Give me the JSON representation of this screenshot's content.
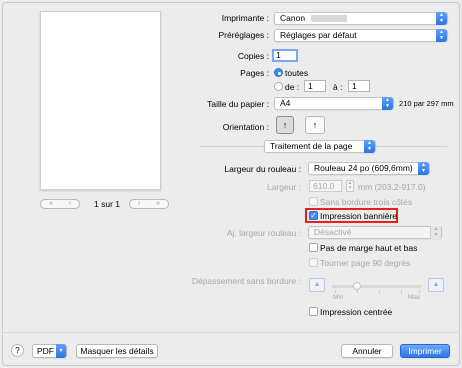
{
  "preview": {
    "page_indicator": "1 sur 1",
    "first_label": "«",
    "prev_label": "‹",
    "next_label": "›",
    "last_label": "»"
  },
  "printer": {
    "label": "Imprimante :",
    "value": "Canon"
  },
  "presets": {
    "label": "Préréglages :",
    "value": "Réglages par défaut"
  },
  "copies": {
    "label": "Copies :",
    "value": "1"
  },
  "pages": {
    "label": "Pages :",
    "all_label": "toutes",
    "from_label": "de :",
    "from_value": "1",
    "to_label": "à :",
    "to_value": "1"
  },
  "paper_size": {
    "label": "Taille du papier :",
    "value": "A4",
    "dims": "210 par 297 mm"
  },
  "orientation": {
    "label": "Orientation :",
    "portrait_glyph": "↑",
    "landscape_glyph": "↑"
  },
  "section": {
    "value": "Traitement de la page"
  },
  "roll_width": {
    "label": "Largeur du rouleau :",
    "value": "Rouleau 24 po (609,6mm)"
  },
  "width": {
    "label": "Largeur :",
    "value": "610.0",
    "unit": "mm (203.2-917.0)"
  },
  "checkboxes": {
    "borderless_three": "Sans bordure trois côtés",
    "banner": "Impression bannière",
    "no_margin": "Pas de marge haut et bas",
    "rotate": "Tourner page 90 degrés",
    "center": "Impression centrée"
  },
  "adjust_width": {
    "label": "Aj. largeur rouleau :",
    "value": "Désactivé"
  },
  "overflow": {
    "label": "Dépassement sans bordure :",
    "min": "Min",
    "max": "Max"
  },
  "footer": {
    "help": "?",
    "pdf": "PDF",
    "hide_details": "Masquer les détails",
    "cancel": "Annuler",
    "print": "Imprimer"
  },
  "colors": {
    "accent": "#3f8cf0",
    "highlight": "#e2231a"
  },
  "state": {
    "banner_checked": true,
    "center_checked": false,
    "all_pages_selected": true
  }
}
